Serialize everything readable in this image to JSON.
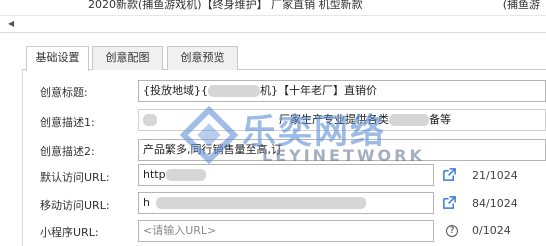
{
  "top_row": {
    "text": "2020新款(捕鱼游戏机)【终身维护】 厂家直销 机型新款",
    "right_text": "(捕鱼游"
  },
  "tabs": [
    {
      "label": "基础设置",
      "active": true
    },
    {
      "label": "创意配图",
      "active": false
    },
    {
      "label": "创意预览",
      "active": false
    }
  ],
  "form": {
    "title_label": "创意标题:",
    "title_value_a": "{投放地域}{",
    "title_value_b": "机}【十年老厂】直销价",
    "desc1_label": "创意描述1:",
    "desc1_value_a": "厂家生产专业提供各类",
    "desc1_value_b": "备等",
    "desc2_label": "创意描述2:",
    "desc2_value": "产品繁多,同行销售量至高,订",
    "pc_url_label": "默认访问URL:",
    "pc_url_value": "http",
    "pc_url_counter": "21/1024",
    "mobile_url_label": "移动访问URL:",
    "mobile_url_value": "h",
    "mobile_url_counter": "84/1024",
    "mini_label": "小程序URL:",
    "mini_placeholder": "<请输入URL>",
    "mini_counter": "0/1024"
  },
  "watermark": {
    "cn": "乐奕网络",
    "en": "LEYINETWORK"
  },
  "colors": {
    "watermark_blue": "#5f91d7",
    "link_icon": "#3a7bd5"
  }
}
